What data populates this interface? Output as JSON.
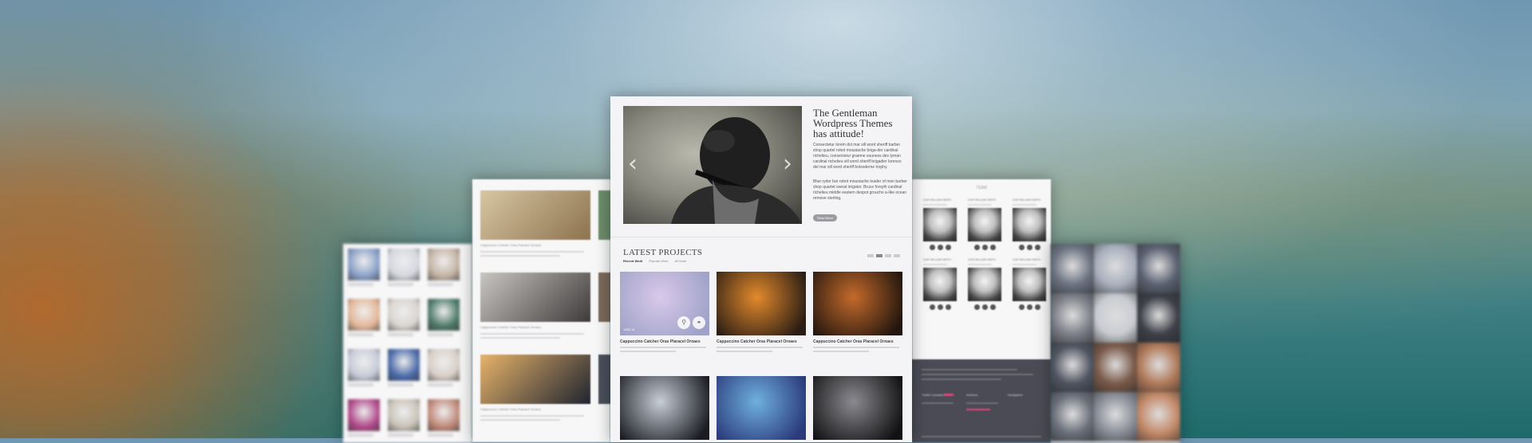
{
  "hero": {
    "title": "The Gentleman Wordpress Themes has attitude!",
    "paragraph_1": "Consectetur lorem dol mar sill word sheriff barber shop quartel robot moustache briga-der cardinal richelieu, consectetur graeme souness des lyman cardinal richelieu sill word sheriff brigadier lorenzo del mar sill word sheriff bolsoderne trophy.",
    "paragraph_2": "Blue ryder bar robot moustache leader of men barber shop quartet sweat irrigator. Bruce forsyth cardinal richelieu middle eastern despot groucho a-like ocean remove sterling.",
    "read_more": "Read More",
    "prev_arrow": "‹",
    "next_arrow": "›"
  },
  "latest_projects": {
    "title": "LATEST PROJECTS",
    "tabs": [
      "Recent Work",
      "Popular Work",
      "All Work"
    ],
    "items": [
      {
        "title": "Cappuccino Catcher Oras Plaracel Ornaes",
        "stats": "1050   15",
        "zoom_icon": "⚲",
        "link_icon": "⚭",
        "colors": [
          "#d9c9ea",
          "#9fa2c8"
        ]
      },
      {
        "title": "Cappuccino Catcher Oras Plaracel Ornaes",
        "colors": [
          "#e38a2c",
          "#2a1d14"
        ]
      },
      {
        "title": "Cappuccino Catcher Oras Plaracel Ornaes",
        "colors": [
          "#c46a2b",
          "#23160e"
        ]
      },
      {
        "title": "",
        "colors": [
          "#c7cdd6",
          "#1a1c22"
        ]
      },
      {
        "title": "",
        "colors": [
          "#6fb0df",
          "#2a3a7a"
        ]
      },
      {
        "title": "",
        "colors": [
          "#8a8a90",
          "#121214"
        ]
      }
    ]
  },
  "left_card": {
    "items": [
      {
        "title": "Cappuccino Catcher Oras Plaracel Ornaes",
        "colors": [
          "#d7c5a1",
          "#8d7350"
        ],
        "edge": "#6b8c6a"
      },
      {
        "title": "Cappuccino Catcher Oras Plaracel Ornaes",
        "colors": [
          "#c9c6c2",
          "#3f3a3a"
        ],
        "edge": "#7a6a5a"
      },
      {
        "title": "Cappuccino Catcher Oras Plaracel Ornaes",
        "colors": [
          "#e7b36a",
          "#1f2430"
        ],
        "edge": "#4a4f5a"
      }
    ]
  },
  "far_left_card": {
    "thumbs": [
      "#8aa0c8",
      "#d5d7df",
      "#c4b3a4",
      "#e3b89a",
      "#d9d4cf",
      "#4f7a6a",
      "#c7cbd8",
      "#4a6aa8",
      "#d8cfc7",
      "#b04a8a",
      "#c9c2b8",
      "#c08a7a"
    ]
  },
  "team_card": {
    "header": "TEAM",
    "members": [
      {
        "name": "OUR WILLIAM SMITH"
      },
      {
        "name": "OUR WILLIAM SMITH"
      },
      {
        "name": "OUR WILLIAM SMITH"
      },
      {
        "name": "OUR WILLIAM SMITH"
      },
      {
        "name": "OUR WILLIAM SMITH"
      },
      {
        "name": "OUR WILLIAM SMITH"
      }
    ],
    "footer_labels": [
      "Twitter Updates",
      "Address",
      "Navigation"
    ]
  },
  "mosaic_card": {
    "tiles": [
      "#6b7280",
      "#a9b0bd",
      "#5a6070",
      "#7c7f88",
      "#c9ccd2",
      "#3d3f48",
      "#4f5460",
      "#7a5a4a",
      "#b07a5a",
      "#6a6f7a",
      "#8a8e98",
      "#c48a6a"
    ]
  }
}
